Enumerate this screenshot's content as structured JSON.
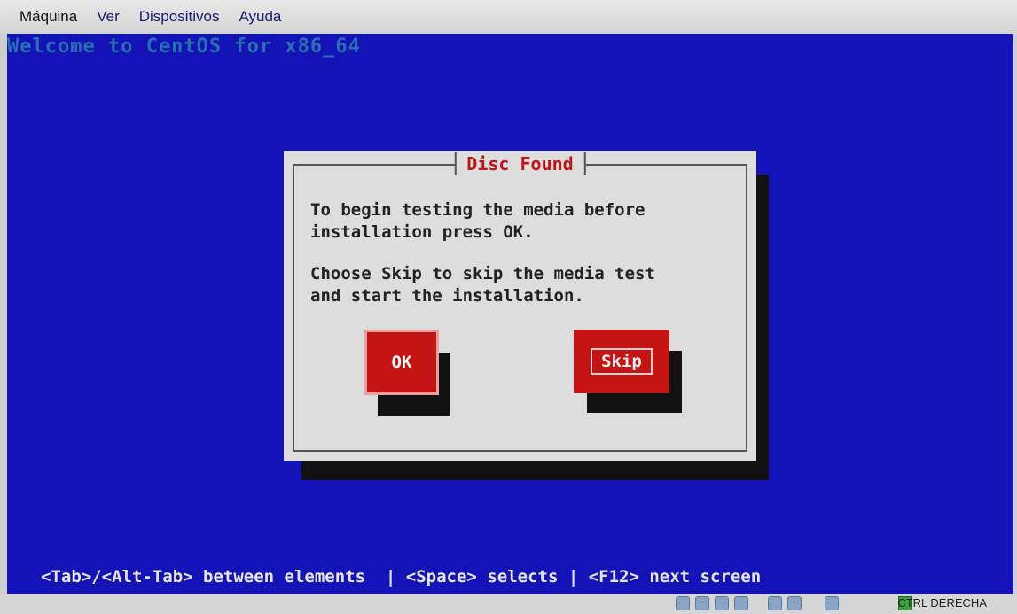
{
  "menubar": {
    "items": [
      "Máquina",
      "Ver",
      "Dispositivos",
      "Ayuda"
    ]
  },
  "console": {
    "welcome": "Welcome to CentOS for x86_64",
    "dialog": {
      "title": "Disc Found",
      "text1": "To begin testing the media before\ninstallation press OK.",
      "text2": "Choose Skip to skip the media test\nand start the installation.",
      "ok_label": "OK",
      "skip_label": "Skip"
    },
    "status_line": "<Tab>/<Alt-Tab> between elements  | <Space> selects | <F12> next screen"
  },
  "statusbar": {
    "icons": [
      "hard-disk-icon",
      "optical-drive-icon",
      "usb-icon",
      "network-icon",
      "shared-folders-icon",
      "display-icon",
      "mouse-integration-icon"
    ],
    "host_key": "CTRL DERECHA"
  },
  "colors": {
    "console_bg": "#1313b8",
    "dialog_bg": "#dddddd",
    "button_bg": "#c41414",
    "title_text": "#c21414"
  }
}
